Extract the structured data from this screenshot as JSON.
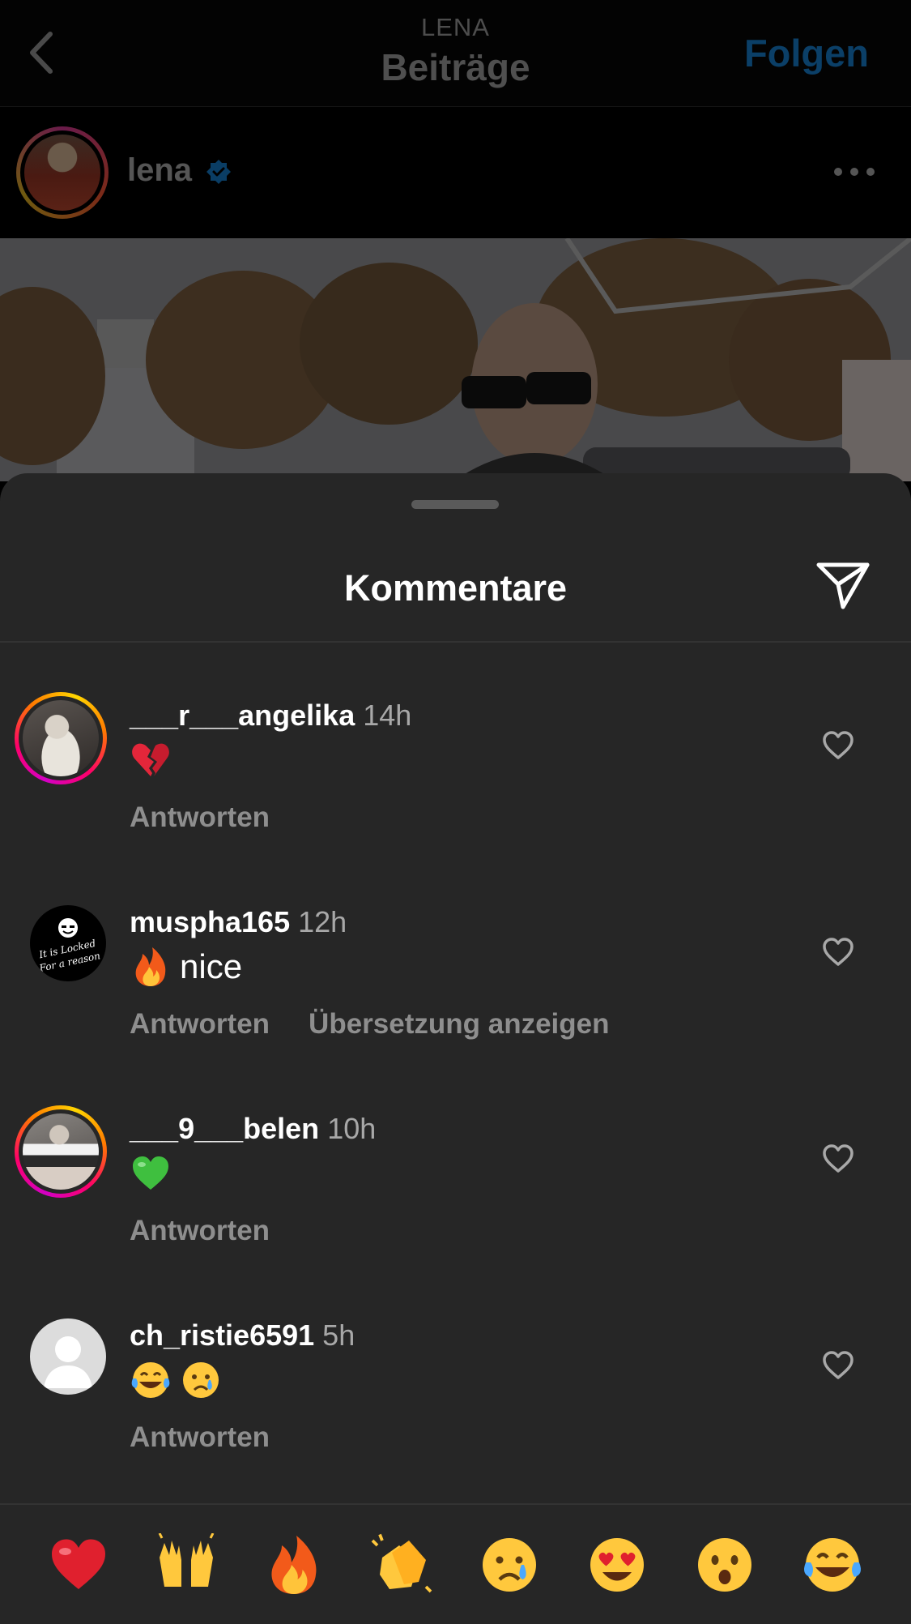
{
  "nav": {
    "supertitle": "LENA",
    "title": "Beiträge",
    "follow_label": "Folgen",
    "back_icon": "chevron-left-icon"
  },
  "post": {
    "username": "lena",
    "verified": true,
    "more_icon": "more-horizontal-icon"
  },
  "sheet": {
    "title": "Kommentare",
    "share_icon": "paper-plane-icon"
  },
  "comments": [
    {
      "username": "___r___angelika",
      "time": "14h",
      "text": "",
      "emojis": [
        "broken-heart"
      ],
      "reply_label": "Antworten",
      "has_story": true
    },
    {
      "username": "muspha165",
      "time": "12h",
      "text": "nice",
      "emojis": [
        "fire"
      ],
      "reply_label": "Antworten",
      "translate_label": "Übersetzung anzeigen",
      "has_story": false
    },
    {
      "username": "___9___belen",
      "time": "10h",
      "text": "",
      "emojis": [
        "green-heart"
      ],
      "reply_label": "Antworten",
      "has_story": true
    },
    {
      "username": "ch_ristie6591",
      "time": "5h",
      "text": "",
      "emojis": [
        "tears-of-joy",
        "crying-face"
      ],
      "reply_label": "Antworten",
      "has_story": false
    }
  ],
  "emoji_bar": [
    "red-heart",
    "raising-hands",
    "fire",
    "clapping-hands",
    "crying-face",
    "heart-eyes",
    "surprised-face",
    "tears-of-joy"
  ],
  "colors": {
    "sheet_bg": "#262626",
    "follow_blue_dimmed": "#0b3f67",
    "secondary_text": "#8e8e8e",
    "story_ring_start": "#d300c5",
    "story_ring_end": "#ffd600"
  }
}
